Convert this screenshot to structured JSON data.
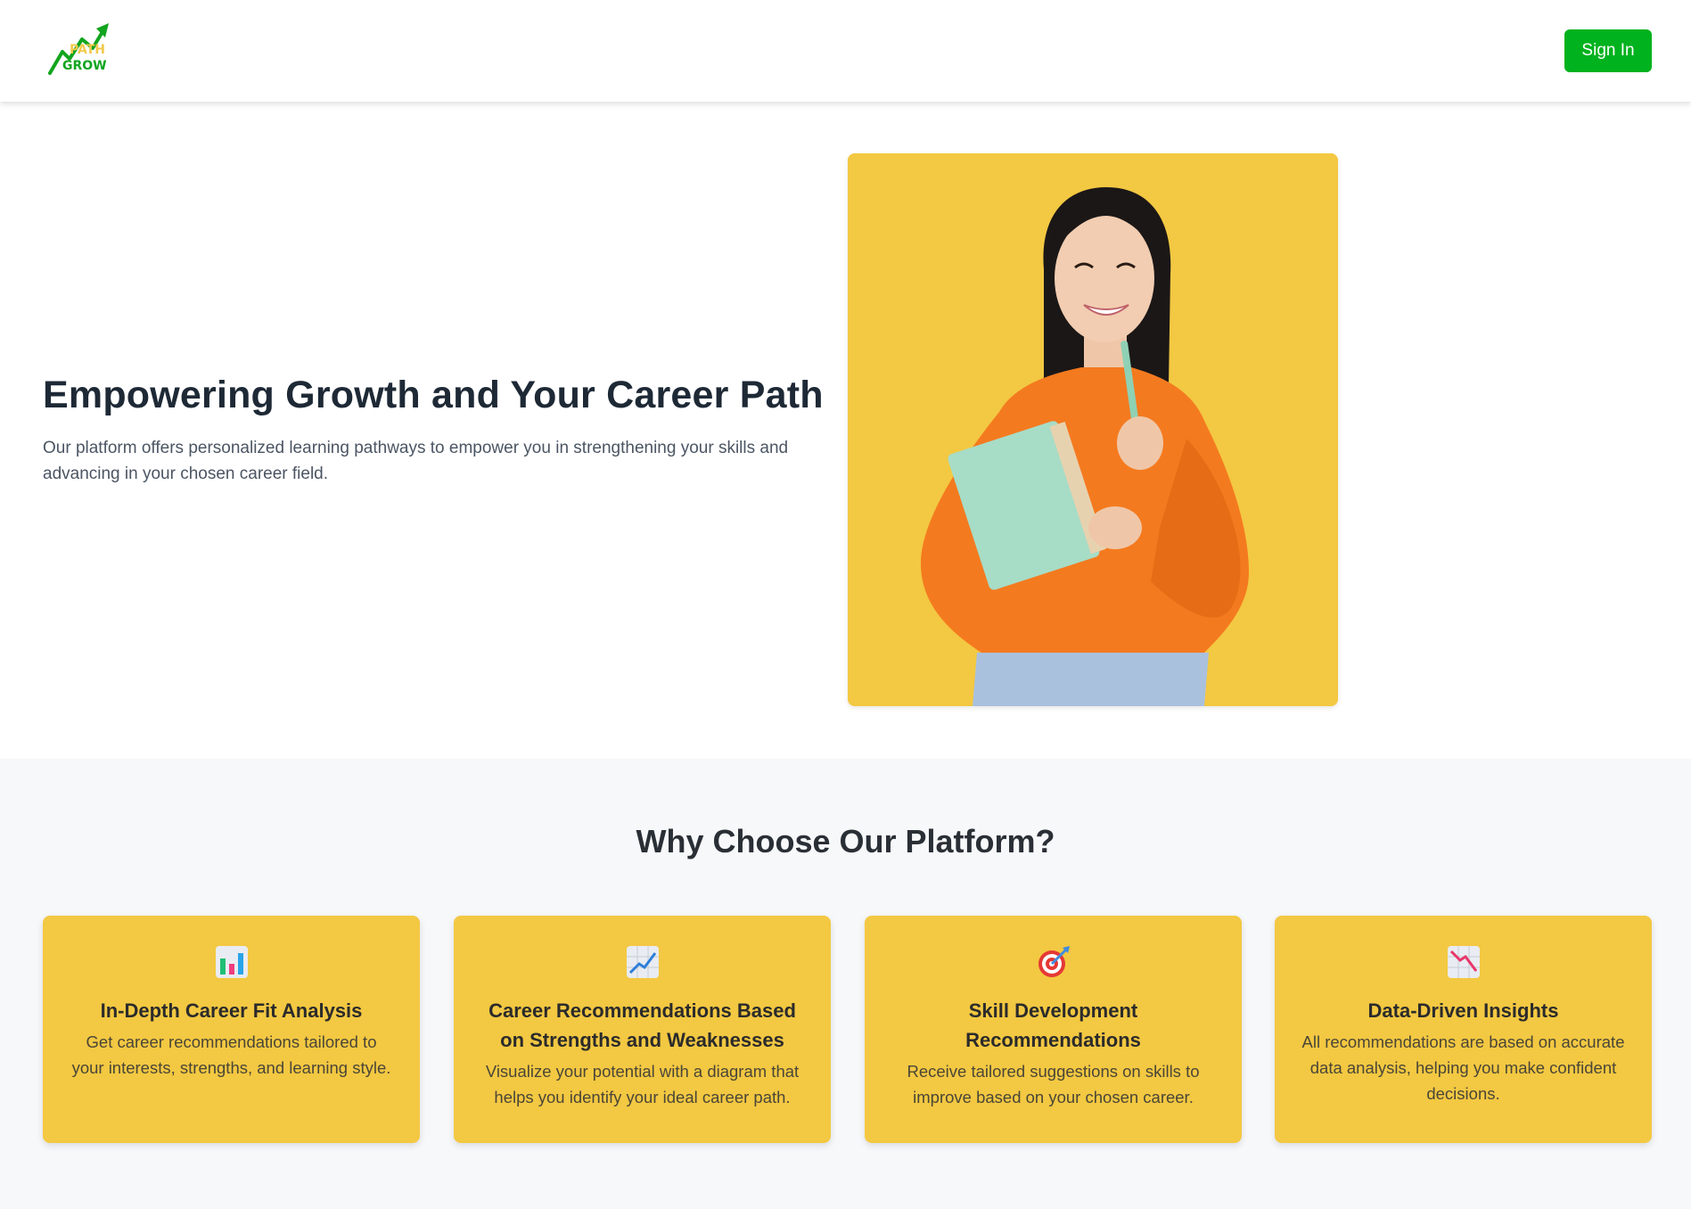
{
  "header": {
    "logo_text_top": "PATH",
    "logo_text_bottom": "GROW",
    "signin_label": "Sign In"
  },
  "hero": {
    "title": "Empowering Growth and Your Career Path",
    "description": "Our platform offers personalized learning pathways to empower you in strengthening your skills and advancing in your chosen career field."
  },
  "features": {
    "title": "Why Choose Our Platform?",
    "cards": [
      {
        "icon": "bar-chart-icon",
        "title": "In-Depth Career Fit Analysis",
        "description": "Get career recommendations tailored to your interests, strengths, and learning style."
      },
      {
        "icon": "chart-increasing-icon",
        "title": "Career Recommendations Based on Strengths and Weaknesses",
        "description": "Visualize your potential with a diagram that helps you identify your ideal career path."
      },
      {
        "icon": "target-icon",
        "title": "Skill Development Recommendations",
        "description": "Receive tailored suggestions on skills to improve based on your chosen career."
      },
      {
        "icon": "chart-decreasing-icon",
        "title": "Data-Driven Insights",
        "description": "All recommendations are based on accurate data analysis, helping you make confident decisions."
      }
    ]
  },
  "colors": {
    "accent_green": "#00b21e",
    "card_yellow": "#f3c842",
    "section_bg": "#f7f8fa"
  }
}
